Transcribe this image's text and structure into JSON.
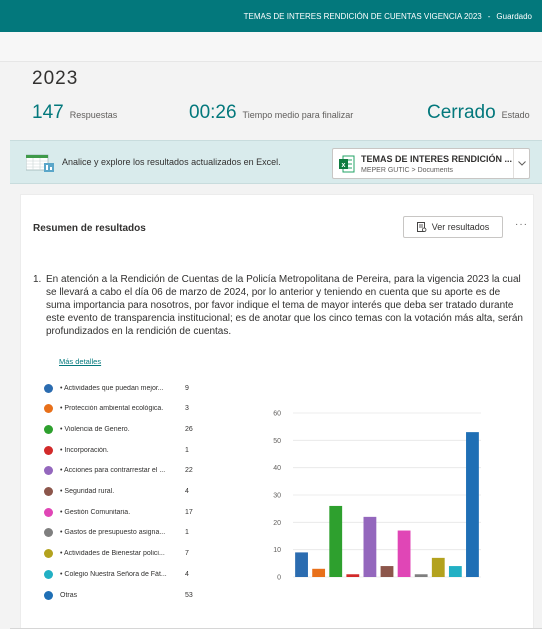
{
  "topbar": {
    "title": "TEMAS DE INTERES RENDICIÓN DE CUENTAS VIGENCIA 2023",
    "separator": "-",
    "status": "Guardado",
    "color": "#03787c"
  },
  "form": {
    "title_fragment": "2023"
  },
  "stats": [
    {
      "value": "147",
      "label": "Respuestas"
    },
    {
      "value": "00:26",
      "label": "Tiempo medio para finalizar"
    },
    {
      "value": "Cerrado",
      "label": "Estado"
    }
  ],
  "excel": {
    "message": "Analice y explore los resultados actualizados en Excel.",
    "file_name": "TEMAS DE INTERES RENDICIÓN ...",
    "file_path": "MEPER GUTIC > Documents",
    "dropdown_icon": "chevron-down-icon"
  },
  "summary": {
    "title": "Resumen de resultados",
    "view_button": "Ver resultados",
    "more_icon": "···"
  },
  "question": {
    "number": "1.",
    "text": "En atención a la Rendición de Cuentas de la Policía Metropolitana de Pereira, para la vigencia 2023 la cual se llevará a cabo el día 06 de marzo de 2024, por lo anterior y teniendo en cuenta que su aporte es de suma importancia para nosotros, por favor indique el tema de mayor interés que deba ser tratado durante este evento de transparencia institucional; es de anotar que los cinco temas con la votación más alta, serán profundizados en la rendición de cuentas.",
    "details_link": "Más detalles"
  },
  "chart_data": {
    "type": "bar",
    "categories": [
      "• Actividades que puedan mejor...",
      "• Protección ambiental ecológica.",
      "• Violencia de Genero.",
      "• Incorporación.",
      "• Acciones para contrarrestar el ...",
      "• Seguridad rural.",
      "• Gestión Comunitaria.",
      "• Gastos de presupuesto asigna...",
      "• Actividades de Bienestar polici...",
      "• Colegio Nuestra Señora de Fát...",
      "Otras"
    ],
    "values": [
      9,
      3,
      26,
      1,
      22,
      4,
      17,
      1,
      7,
      4,
      53
    ],
    "colors": [
      "#2b6cb0",
      "#e8701a",
      "#2ea02e",
      "#d22a2a",
      "#9467bd",
      "#8c564b",
      "#e046b6",
      "#7f7f7f",
      "#b3a21e",
      "#22b0c4",
      "#1f6fb5"
    ],
    "ylim": [
      0,
      60
    ],
    "yticks": [
      "0",
      "10",
      "20",
      "30",
      "40",
      "50",
      "60"
    ],
    "grid": true
  }
}
